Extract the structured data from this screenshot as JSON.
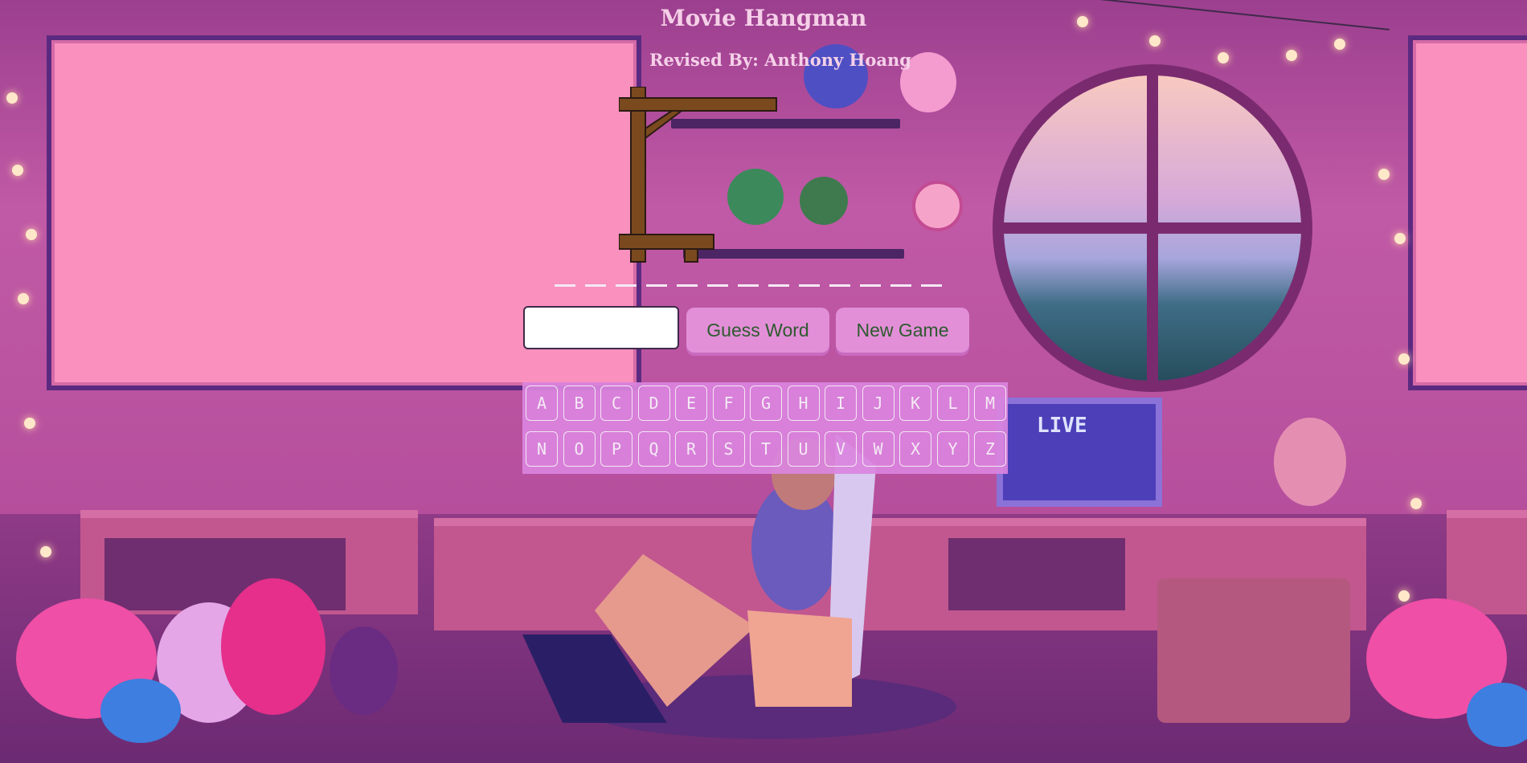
{
  "header": {
    "title": "Movie Hangman",
    "subtitle": "Revised By: Anthony Hoang"
  },
  "controls": {
    "guess_input_value": "",
    "guess_word_label": "Guess Word",
    "new_game_label": "New Game"
  },
  "keyboard": {
    "row1": [
      "A",
      "B",
      "C",
      "D",
      "E",
      "F",
      "G",
      "H",
      "I",
      "J",
      "K",
      "L",
      "M"
    ],
    "row2": [
      "N",
      "O",
      "P",
      "Q",
      "R",
      "S",
      "T",
      "U",
      "V",
      "W",
      "X",
      "Y",
      "Z"
    ]
  },
  "scene": {
    "monitor_text": "LIVE"
  },
  "colors": {
    "board": "#f990bd",
    "button_bg": "#e28fd8",
    "button_text": "#2e5a2e",
    "keyboard_bg": "#da84de",
    "title_text": "#f5d0e8"
  }
}
